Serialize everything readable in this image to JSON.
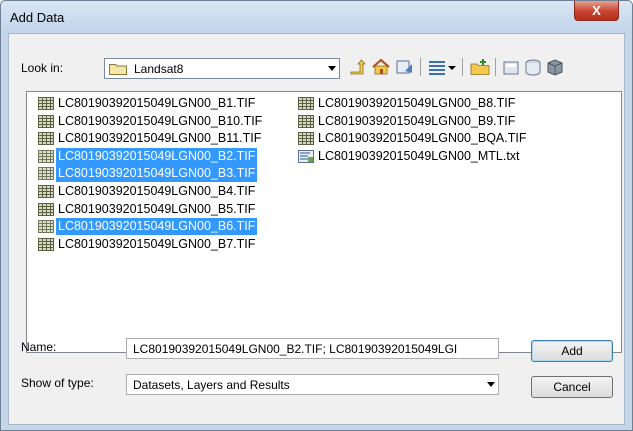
{
  "window": {
    "title": "Add Data",
    "close_glyph": "X"
  },
  "toolbar": {
    "look_in_label": "Look in:",
    "look_in_value": "Landsat8",
    "buttons": [
      "up-one-level-icon",
      "home-icon",
      "catalog-connect-icon",
      "view-details-icon",
      "view-options-icon",
      "new-folder-icon",
      "connect-folder-icon",
      "new-database-icon",
      "new-geodatabase-icon"
    ]
  },
  "files": {
    "column1": [
      {
        "name": "LC80190392015049LGN00_B1.TIF",
        "selected": false
      },
      {
        "name": "LC80190392015049LGN00_B10.TIF",
        "selected": false
      },
      {
        "name": "LC80190392015049LGN00_B11.TIF",
        "selected": false
      },
      {
        "name": "LC80190392015049LGN00_B2.TIF",
        "selected": true
      },
      {
        "name": "LC80190392015049LGN00_B3.TIF",
        "selected": true
      },
      {
        "name": "LC80190392015049LGN00_B4.TIF",
        "selected": false
      },
      {
        "name": "LC80190392015049LGN00_B5.TIF",
        "selected": false
      },
      {
        "name": "LC80190392015049LGN00_B6.TIF",
        "selected": true
      },
      {
        "name": "LC80190392015049LGN00_B7.TIF",
        "selected": false
      }
    ],
    "column2": [
      {
        "name": "LC80190392015049LGN00_B8.TIF",
        "selected": false
      },
      {
        "name": "LC80190392015049LGN00_B9.TIF",
        "selected": false
      },
      {
        "name": "LC80190392015049LGN00_BQA.TIF",
        "selected": false
      },
      {
        "name": "LC80190392015049LGN00_MTL.txt",
        "selected": false
      }
    ]
  },
  "name_field": {
    "label": "Name:",
    "value": "LC80190392015049LGN00_B2.TIF; LC80190392015049LGI"
  },
  "type_field": {
    "label": "Show of type:",
    "value": "Datasets, Layers and Results"
  },
  "buttons": {
    "add": "Add",
    "cancel": "Cancel"
  },
  "colors": {
    "selection": "#3399ff",
    "titlebar": "#c5d6ea",
    "close": "#c8432f"
  }
}
